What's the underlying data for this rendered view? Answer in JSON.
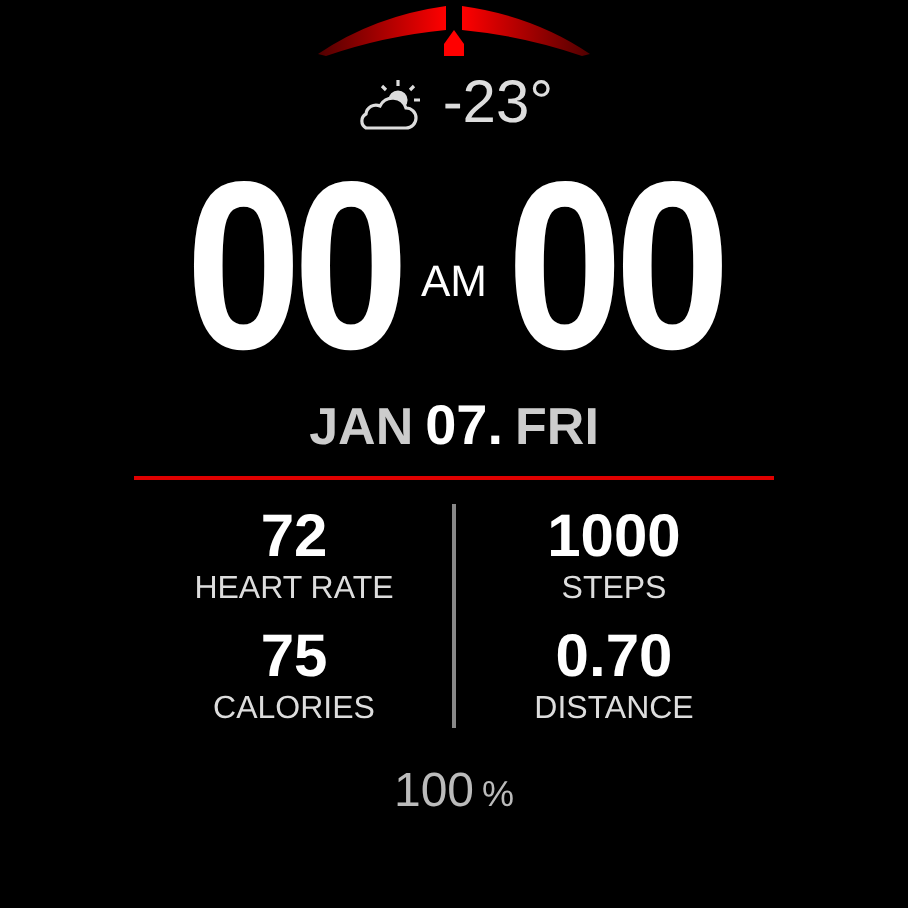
{
  "weather": {
    "temperature": "-23°"
  },
  "time": {
    "hour": "00",
    "period": "AM",
    "minute": "00"
  },
  "date": {
    "month": "JAN",
    "day": "07.",
    "weekday": "FRI"
  },
  "stats": [
    {
      "value": "72",
      "label": "HEART RATE"
    },
    {
      "value": "1000",
      "label": "STEPS"
    },
    {
      "value": "75",
      "label": "CALORIES"
    },
    {
      "value": "0.70",
      "label": "DISTANCE"
    }
  ],
  "battery": {
    "value": "100",
    "unit": "%"
  }
}
